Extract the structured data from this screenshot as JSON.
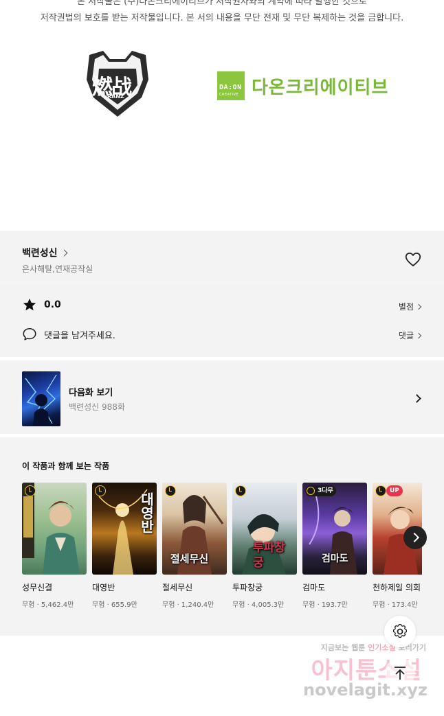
{
  "copyright": {
    "line1": "본 저작물은 (주)다온크리에이티브가 저작권자와의 계약에 따라 발행한 것으로",
    "line2": "저작권법의 보호를 받는 저작물입니다. 본 서의 내용을 무단 전재 및 무단 복제하는 것을 금합니다."
  },
  "logos": {
    "left_text": "燃战",
    "left_sub": "RANZ",
    "right_box_main": "DA:ON",
    "right_box_sub": "CREATIVE",
    "right_text": "다온크리에이티브"
  },
  "work": {
    "title": "백련성신",
    "authors": "은사해탈,연재공작실"
  },
  "rating": {
    "score": "0.0",
    "link": "별점"
  },
  "comment": {
    "placeholder": "댓글을 남겨주세요.",
    "link": "댓글"
  },
  "next_episode": {
    "label": "다음화 보기",
    "sub": "백련성신 988화"
  },
  "recommend": {
    "title": "이 작품과 함께 보는 작품",
    "items": [
      {
        "name": "성무신결",
        "meta": "무협 · 5,462.4만",
        "badge": "clock",
        "cover_text": ""
      },
      {
        "name": "대영반",
        "meta": "무협 · 655.9만",
        "badge": "clock",
        "cover_text": "대영반"
      },
      {
        "name": "절세무신",
        "meta": "무협 · 1,240.4만",
        "badge": "clock",
        "cover_text": "절세무신"
      },
      {
        "name": "투파창궁",
        "meta": "무협 · 4,005.3만",
        "badge": "clock",
        "cover_text": "투파창궁"
      },
      {
        "name": "검마도",
        "meta": "무협 · 193.7만",
        "badge": "3다무",
        "cover_text": "검마도"
      },
      {
        "name": "천하제일 의회",
        "meta": "무협 · 173.4만",
        "badge": "UP",
        "cover_text": ""
      }
    ]
  },
  "watermark": {
    "top_gray": "지금보는 웹툰",
    "top_pink": "인기소설",
    "top_gray2": "보러가기",
    "mid": "아지툰소설",
    "bot": "novelagit.xyz"
  },
  "colors": {
    "accent_green": "#8cc63f",
    "badge_yellow": "#f5c518",
    "up_red": "#e8344e"
  },
  "icons": [
    "heart-icon",
    "star-icon",
    "comment-icon",
    "chevron-right-icon",
    "settings-icon",
    "scroll-top-icon"
  ]
}
